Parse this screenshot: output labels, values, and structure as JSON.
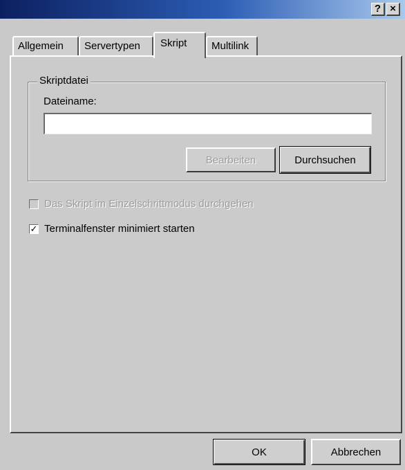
{
  "title_buttons": {
    "help": "?",
    "close": "×"
  },
  "tabs": [
    {
      "label": "Allgemein"
    },
    {
      "label": "Servertypen"
    },
    {
      "label": "Skript",
      "active": true
    },
    {
      "label": "Multilink"
    }
  ],
  "skriptdatei": {
    "group_label": "Skriptdatei",
    "filename_label": "Dateiname:",
    "filename_value": "",
    "edit_button": "Bearbeiten",
    "browse_button": "Durchsuchen"
  },
  "options": {
    "step_mode_label": "Das Skript im Einzelschrittmodus durchgehen",
    "step_mode_checked": false,
    "step_mode_enabled": false,
    "terminal_minimized_label": "Terminalfenster minimiert starten",
    "terminal_minimized_checked": true
  },
  "footer": {
    "ok_button": "OK",
    "cancel_button": "Abbrechen"
  },
  "colors": {
    "title_gradient_start": "#0c2060",
    "title_gradient_end": "#a8c8ec",
    "face": "#cbcbcb",
    "disabled_text": "#9c9c9c"
  }
}
